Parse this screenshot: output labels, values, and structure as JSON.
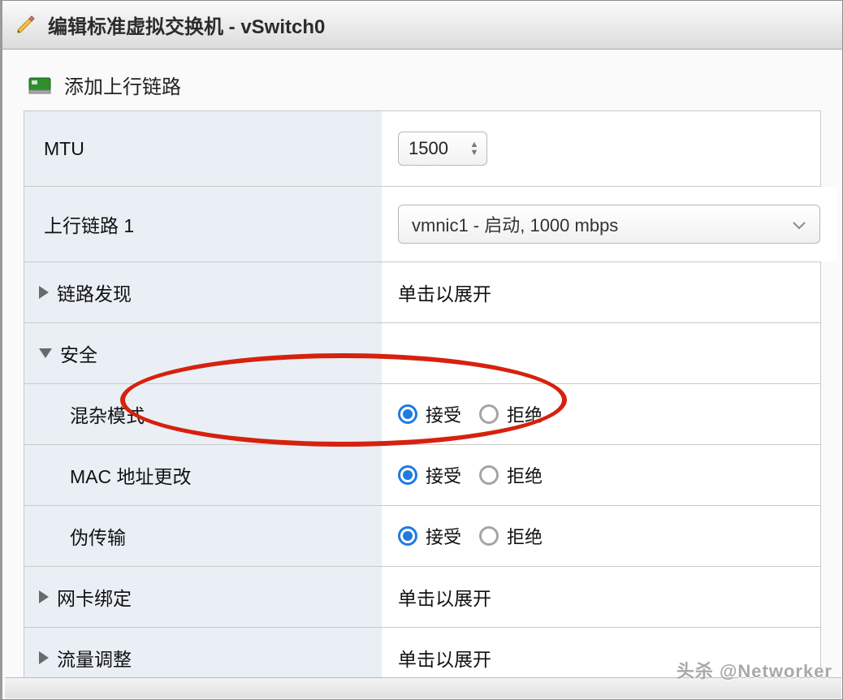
{
  "title": "编辑标准虚拟交换机 - vSwitch0",
  "section": {
    "add_uplink": "添加上行链路"
  },
  "labels": {
    "mtu": "MTU",
    "uplink1": "上行链路 1",
    "link_discovery": "链路发现",
    "security": "安全",
    "promiscuous": "混杂模式",
    "mac_change": "MAC 地址更改",
    "forged": "伪传输",
    "nic_teaming": "网卡绑定",
    "traffic_shaping": "流量调整"
  },
  "values": {
    "mtu": "1500",
    "uplink1_selected": "vmnic1 - 启动, 1000 mbps",
    "click_expand": "单击以展开"
  },
  "radio": {
    "accept": "接受",
    "reject": "拒绝"
  },
  "security": {
    "promiscuous": "accept",
    "mac_change": "accept",
    "forged": "accept"
  },
  "watermark": "头杀 @Networker"
}
